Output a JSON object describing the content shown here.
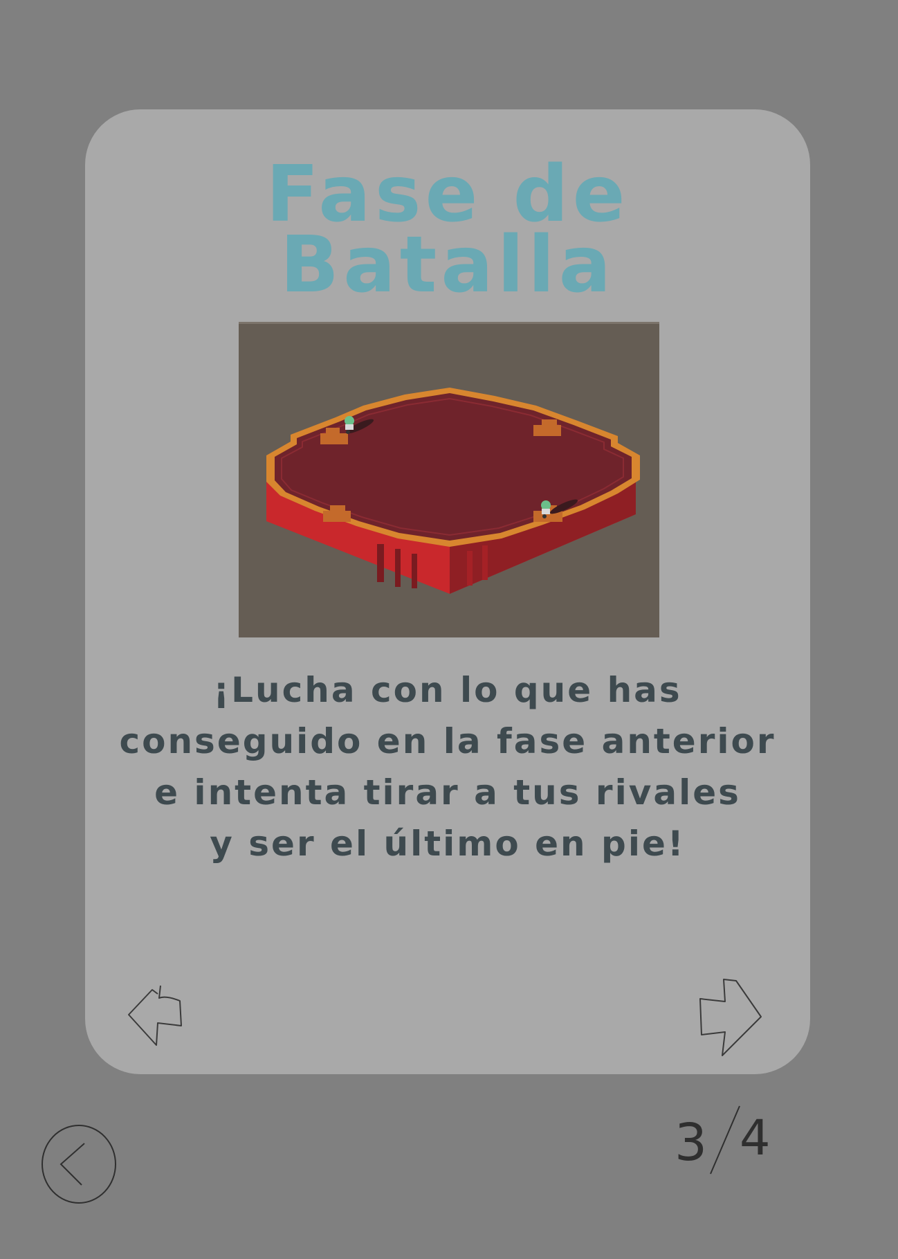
{
  "card": {
    "title_line1": "Fase de",
    "title_line2": "Batalla",
    "description": [
      "¡Lucha con lo que has",
      "conseguido en la fase anterior",
      "e intenta tirar a tus rivales",
      "y ser el último en pie!"
    ]
  },
  "pagination": {
    "current": "3",
    "total": "4"
  },
  "colors": {
    "background": "#808080",
    "card": "#a9a9a9",
    "title": "#6aa9b4",
    "text": "#3e4a4f",
    "arena_top": "#6f232b",
    "arena_side": "#c9282c",
    "arena_border": "#d8862f"
  },
  "icons": {
    "prev": "left-arrow-icon",
    "next": "right-arrow-icon",
    "back": "back-chevron-icon"
  }
}
